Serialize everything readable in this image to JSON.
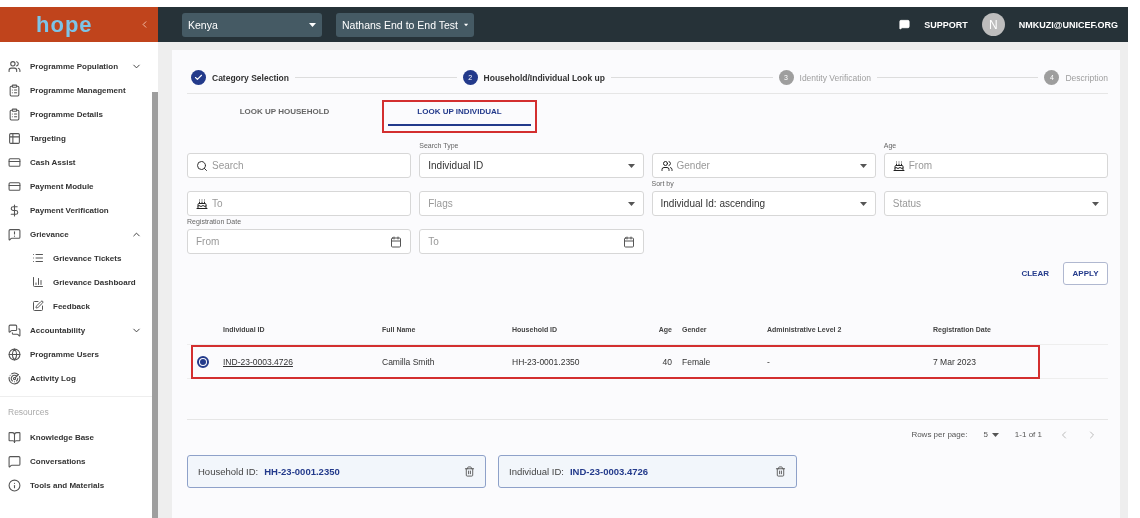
{
  "sidebar": {
    "logo": "hope",
    "items": [
      {
        "kind": "item",
        "label": "Programme Population",
        "expanded": false
      },
      {
        "kind": "item",
        "label": "Programme Management"
      },
      {
        "kind": "item",
        "label": "Programme Details"
      },
      {
        "kind": "item",
        "label": "Targeting"
      },
      {
        "kind": "item",
        "label": "Cash Assist"
      },
      {
        "kind": "item",
        "label": "Payment Module"
      },
      {
        "kind": "item",
        "label": "Payment Verification"
      },
      {
        "kind": "item",
        "label": "Grievance",
        "expanded": true,
        "children": [
          {
            "label": "Grievance Tickets"
          },
          {
            "label": "Grievance Dashboard"
          },
          {
            "label": "Feedback"
          }
        ]
      },
      {
        "kind": "item",
        "label": "Accountability",
        "expanded": false
      },
      {
        "kind": "item",
        "label": "Programme Users"
      },
      {
        "kind": "item",
        "label": "Activity Log"
      },
      {
        "kind": "section",
        "label": "Resources"
      },
      {
        "kind": "item",
        "label": "Knowledge Base"
      },
      {
        "kind": "item",
        "label": "Conversations"
      },
      {
        "kind": "item",
        "label": "Tools and Materials"
      }
    ]
  },
  "header": {
    "selects": [
      "Kenya",
      "Nathans End to End Test"
    ],
    "support": "SUPPORT",
    "avatar": "N",
    "user": "NMKUZI@UNICEF.ORG"
  },
  "stepper": [
    {
      "label": "Category Selection",
      "completed": true
    },
    {
      "number": "2",
      "label": "Household/Individual Look up",
      "completed": false,
      "active": true
    },
    {
      "number": "3",
      "label": "Identity Verification",
      "completed": false,
      "active": false
    },
    {
      "number": "4",
      "label": "Description",
      "completed": false,
      "active": false
    }
  ],
  "tabs": [
    {
      "label": "LOOK UP HOUSEHOLD",
      "selected": false,
      "highlighted": false
    },
    {
      "label": "LOOK UP INDIVIDUAL",
      "selected": true,
      "highlighted": true
    }
  ],
  "filters": [
    {
      "kind": "search",
      "placeholder": "Search"
    },
    {
      "kind": "select",
      "label": "Search Type",
      "value": "Individual ID"
    },
    {
      "kind": "people-select",
      "placeholder": "Gender"
    },
    {
      "kind": "age",
      "label": "Age",
      "placeholder": "From"
    },
    {
      "kind": "age",
      "placeholder": "To"
    },
    {
      "kind": "select",
      "placeholder": "Flags"
    },
    {
      "kind": "select",
      "label": "Sort by",
      "value": "Individual Id: ascending"
    },
    {
      "kind": "select",
      "placeholder": "Status"
    },
    {
      "kind": "date",
      "label": "Registration Date",
      "placeholder": "From"
    },
    {
      "kind": "date",
      "placeholder": "To"
    }
  ],
  "actions": {
    "clear": "CLEAR",
    "apply": "APPLY"
  },
  "table": {
    "columns": [
      "Individual ID",
      "Full Name",
      "Household ID",
      "Age",
      "Gender",
      "Administrative Level 2",
      "Registration Date"
    ],
    "rows": [
      {
        "selected": true,
        "highlighted": true,
        "cells": [
          "IND-23-0003.4726",
          "Camilla Smith",
          "HH-23-0001.2350",
          "40",
          "Female",
          "-",
          "7 Mar 2023"
        ]
      }
    ]
  },
  "pagination": {
    "label": "Rows per page:",
    "per_page": "5",
    "range": "1-1 of 1"
  },
  "chips": [
    {
      "label": "Household ID:",
      "value": "HH-23-0001.2350"
    },
    {
      "label": "Individual ID:",
      "value": "IND-23-0003.4726"
    }
  ]
}
